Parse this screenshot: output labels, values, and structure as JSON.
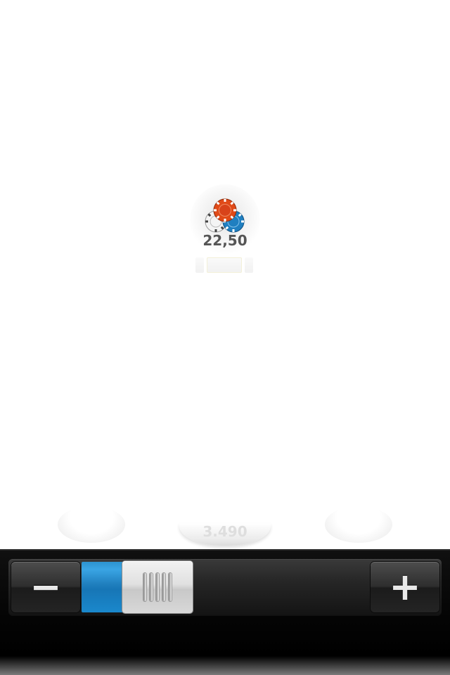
{
  "table": {
    "pot_amount": "22,50",
    "my_stack_amount": "3.490",
    "chips_icon": "poker-chips-icon"
  },
  "bet_slider": {
    "decrease_label": "−",
    "increase_label": "+",
    "decrease_icon": "minus-icon",
    "increase_icon": "plus-icon",
    "fill_fraction": 0.1,
    "accent_color": "#1f7ebd"
  }
}
